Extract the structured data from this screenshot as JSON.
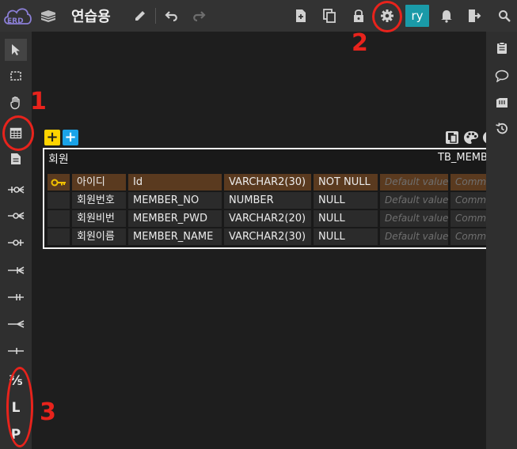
{
  "app": {
    "logo_text": "ERD",
    "title": "연습용",
    "user_initials": "ry",
    "accent_color": "#1a9aa8"
  },
  "topbar_icons": [
    "erd-cloud-logo-icon",
    "book-icon",
    "pencil-icon",
    "undo-icon",
    "redo-icon",
    "new-document-icon",
    "copy-icon",
    "lock-icon",
    "gear-icon",
    "bell-icon",
    "exit-icon",
    "search-icon"
  ],
  "left_toolbar": {
    "icons": [
      "cursor-icon",
      "select-rect-icon",
      "hand-icon",
      "table-add-icon",
      "memo-icon",
      "relation-zero-one-icon",
      "relation-zero-many-icon",
      "relation-one-icon",
      "relation-one-many-icon",
      "relation-one-one-icon",
      "relation-many-icon",
      "relation-line-icon"
    ],
    "text_tools": [
      "⅗",
      "L",
      "P"
    ]
  },
  "right_toolbar": {
    "icons": [
      "clipboard-icon",
      "comment-icon",
      "database-icon",
      "history-icon"
    ]
  },
  "canvas": {
    "add_buttons": [
      "+",
      "+"
    ],
    "table": {
      "name": "회원",
      "comment": "TB_MEMBER",
      "rows": [
        {
          "pk": true,
          "logical": "아이디",
          "physical": "Id",
          "type": "VARCHAR2(30)",
          "nullable": "NOT NULL",
          "default": "Default value",
          "comment": "Comment"
        },
        {
          "pk": false,
          "logical": "회원번호",
          "physical": "MEMBER_NO",
          "type": "NUMBER",
          "nullable": "NULL",
          "default": "Default value",
          "comment": "Comment"
        },
        {
          "pk": false,
          "logical": "회원비번",
          "physical": "MEMBER_PWD",
          "type": "VARCHAR2(20)",
          "nullable": "NULL",
          "default": "Default value",
          "comment": "Comment"
        },
        {
          "pk": false,
          "logical": "회원이름",
          "physical": "MEMBER_NAME",
          "type": "VARCHAR2(30)",
          "nullable": "NULL",
          "default": "Default value",
          "comment": "Comment"
        }
      ]
    }
  },
  "annotations": {
    "labels": [
      "1",
      "2",
      "3"
    ],
    "color": "#e8231c"
  }
}
